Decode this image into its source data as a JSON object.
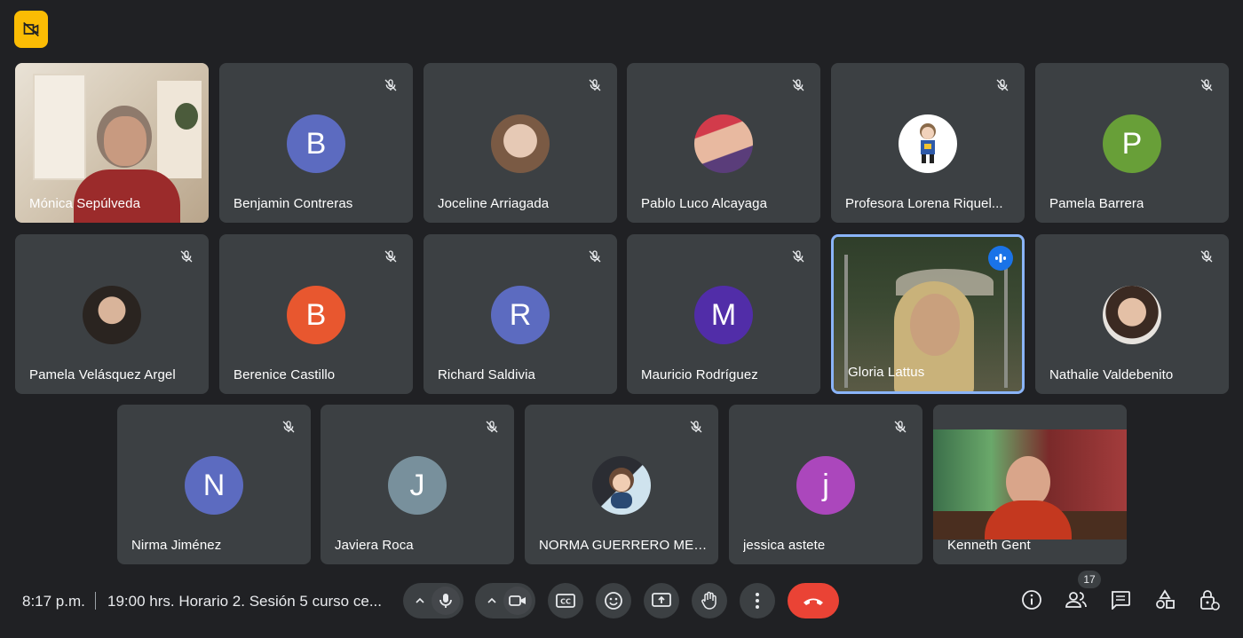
{
  "toolbar_badge_icon": "recording-off-icon",
  "participants": [
    {
      "name": "Mónica Sepúlveda",
      "type": "video",
      "muted": false
    },
    {
      "name": "Benjamin Contreras",
      "type": "letter",
      "letter": "B",
      "color": "#5c6bc0",
      "muted": true
    },
    {
      "name": "Joceline Arriagada",
      "type": "photo",
      "muted": true
    },
    {
      "name": "Pablo Luco Alcayaga",
      "type": "photo",
      "muted": true
    },
    {
      "name": "Profesora Lorena Riquel...",
      "type": "photo",
      "muted": true
    },
    {
      "name": "Pamela Barrera",
      "type": "letter",
      "letter": "P",
      "color": "#689f38",
      "muted": true
    },
    {
      "name": "Pamela Velásquez Argel",
      "type": "photo",
      "muted": true
    },
    {
      "name": "Berenice Castillo",
      "type": "letter",
      "letter": "B",
      "color": "#e8572f",
      "muted": true
    },
    {
      "name": "Richard Saldivia",
      "type": "letter",
      "letter": "R",
      "color": "#5c6bc0",
      "muted": true
    },
    {
      "name": "Mauricio Rodríguez",
      "type": "letter",
      "letter": "M",
      "color": "#512da8",
      "muted": true
    },
    {
      "name": "Gloria Lattus",
      "type": "video",
      "muted": false,
      "speaking": true
    },
    {
      "name": "Nathalie Valdebenito",
      "type": "photo",
      "muted": true
    },
    {
      "name": "Nirma Jiménez",
      "type": "letter",
      "letter": "N",
      "color": "#5c6bc0",
      "muted": true
    },
    {
      "name": "Javiera Roca",
      "type": "letter",
      "letter": "J",
      "color": "#78909c",
      "muted": true
    },
    {
      "name": "NORMA GUERRERO MED...",
      "type": "photo",
      "muted": true
    },
    {
      "name": "jessica astete",
      "type": "letter",
      "letter": "j",
      "color": "#ab47bc",
      "muted": true
    },
    {
      "name": "Kenneth Gent",
      "type": "video",
      "muted": false
    }
  ],
  "bottom": {
    "time": "8:17 p.m.",
    "meeting_title": "19:00 hrs. Horario 2. Sesión 5 curso ce...",
    "participant_count": "17"
  },
  "controls": {
    "mic_icon": "microphone-icon",
    "camera_icon": "camera-icon",
    "captions_icon": "closed-captions-icon",
    "reactions_icon": "emoji-icon",
    "present_icon": "present-screen-icon",
    "raise_hand_icon": "raise-hand-icon",
    "more_icon": "more-options-icon",
    "end_call_icon": "end-call-icon",
    "end_call_color": "#ea4335"
  },
  "right_controls": [
    "info-icon",
    "people-icon",
    "chat-icon",
    "activities-icon",
    "host-controls-icon"
  ],
  "accent": "#8ab4f8"
}
